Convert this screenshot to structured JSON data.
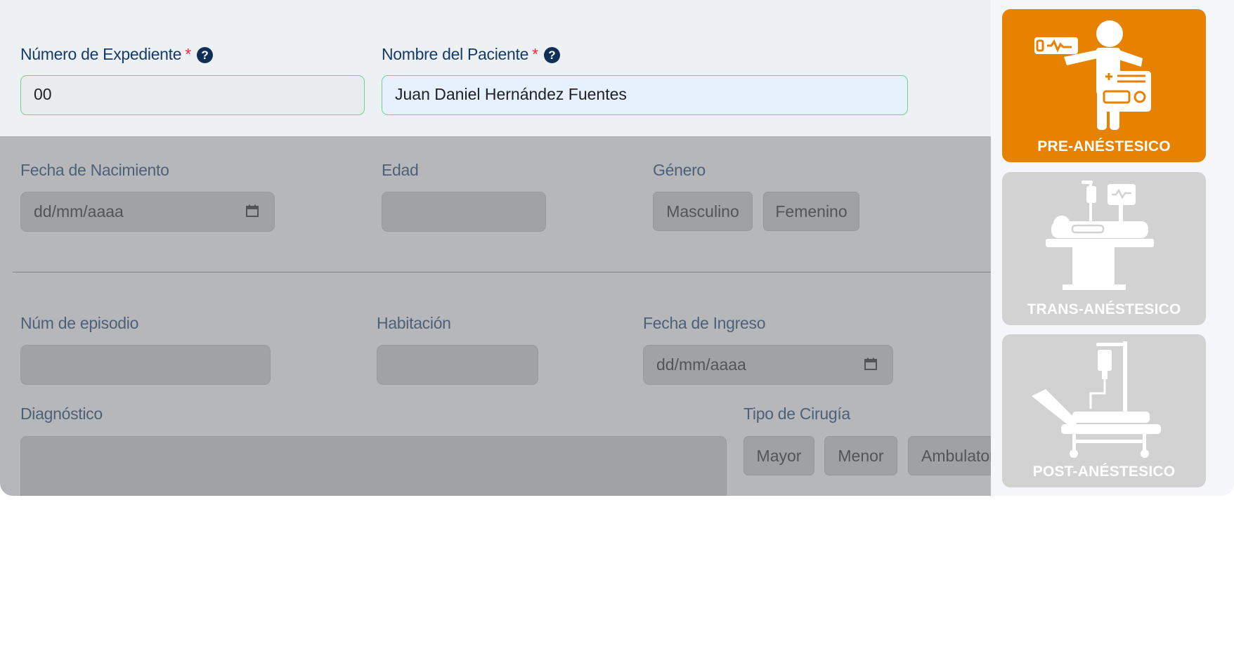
{
  "patient": {
    "expediente_label": "Número de Expediente",
    "expediente_value": "00",
    "nombre_label": "Nombre del Paciente",
    "nombre_value": "Juan Daniel Hernández Fuentes",
    "required_mark": "*",
    "help_glyph": "?"
  },
  "birth": {
    "fecha_label": "Fecha de Nacimiento",
    "fecha_placeholder": "dd/mm/aaaa",
    "edad_label": "Edad",
    "edad_value": "",
    "genero_label": "Género",
    "genero_options": [
      "Masculino",
      "Femenino"
    ]
  },
  "episode": {
    "episodio_label": "Núm de episodio",
    "episodio_value": "",
    "habitacion_label": "Habitación",
    "habitacion_value": "",
    "ingreso_label": "Fecha de Ingreso",
    "ingreso_placeholder": "dd/mm/aaaa",
    "diagnostico_label": "Diagnóstico",
    "diagnostico_value": "",
    "cirugia_label": "Tipo de Cirugía",
    "cirugia_options": [
      "Mayor",
      "Menor",
      "Ambulatoria"
    ]
  },
  "stages": [
    {
      "label": "PRE-ANÉSTESICO",
      "active": true,
      "icon": "pre-anesthesia-icon"
    },
    {
      "label": "TRANS-ANÉSTESICO",
      "active": false,
      "icon": "trans-anesthesia-icon"
    },
    {
      "label": "POST-ANÉSTESICO",
      "active": false,
      "icon": "post-anesthesia-icon"
    }
  ],
  "colors": {
    "accent_orange": "#e68200",
    "label_blue": "#173b67",
    "required_red": "#e0313a",
    "valid_green": "#71d28e"
  }
}
